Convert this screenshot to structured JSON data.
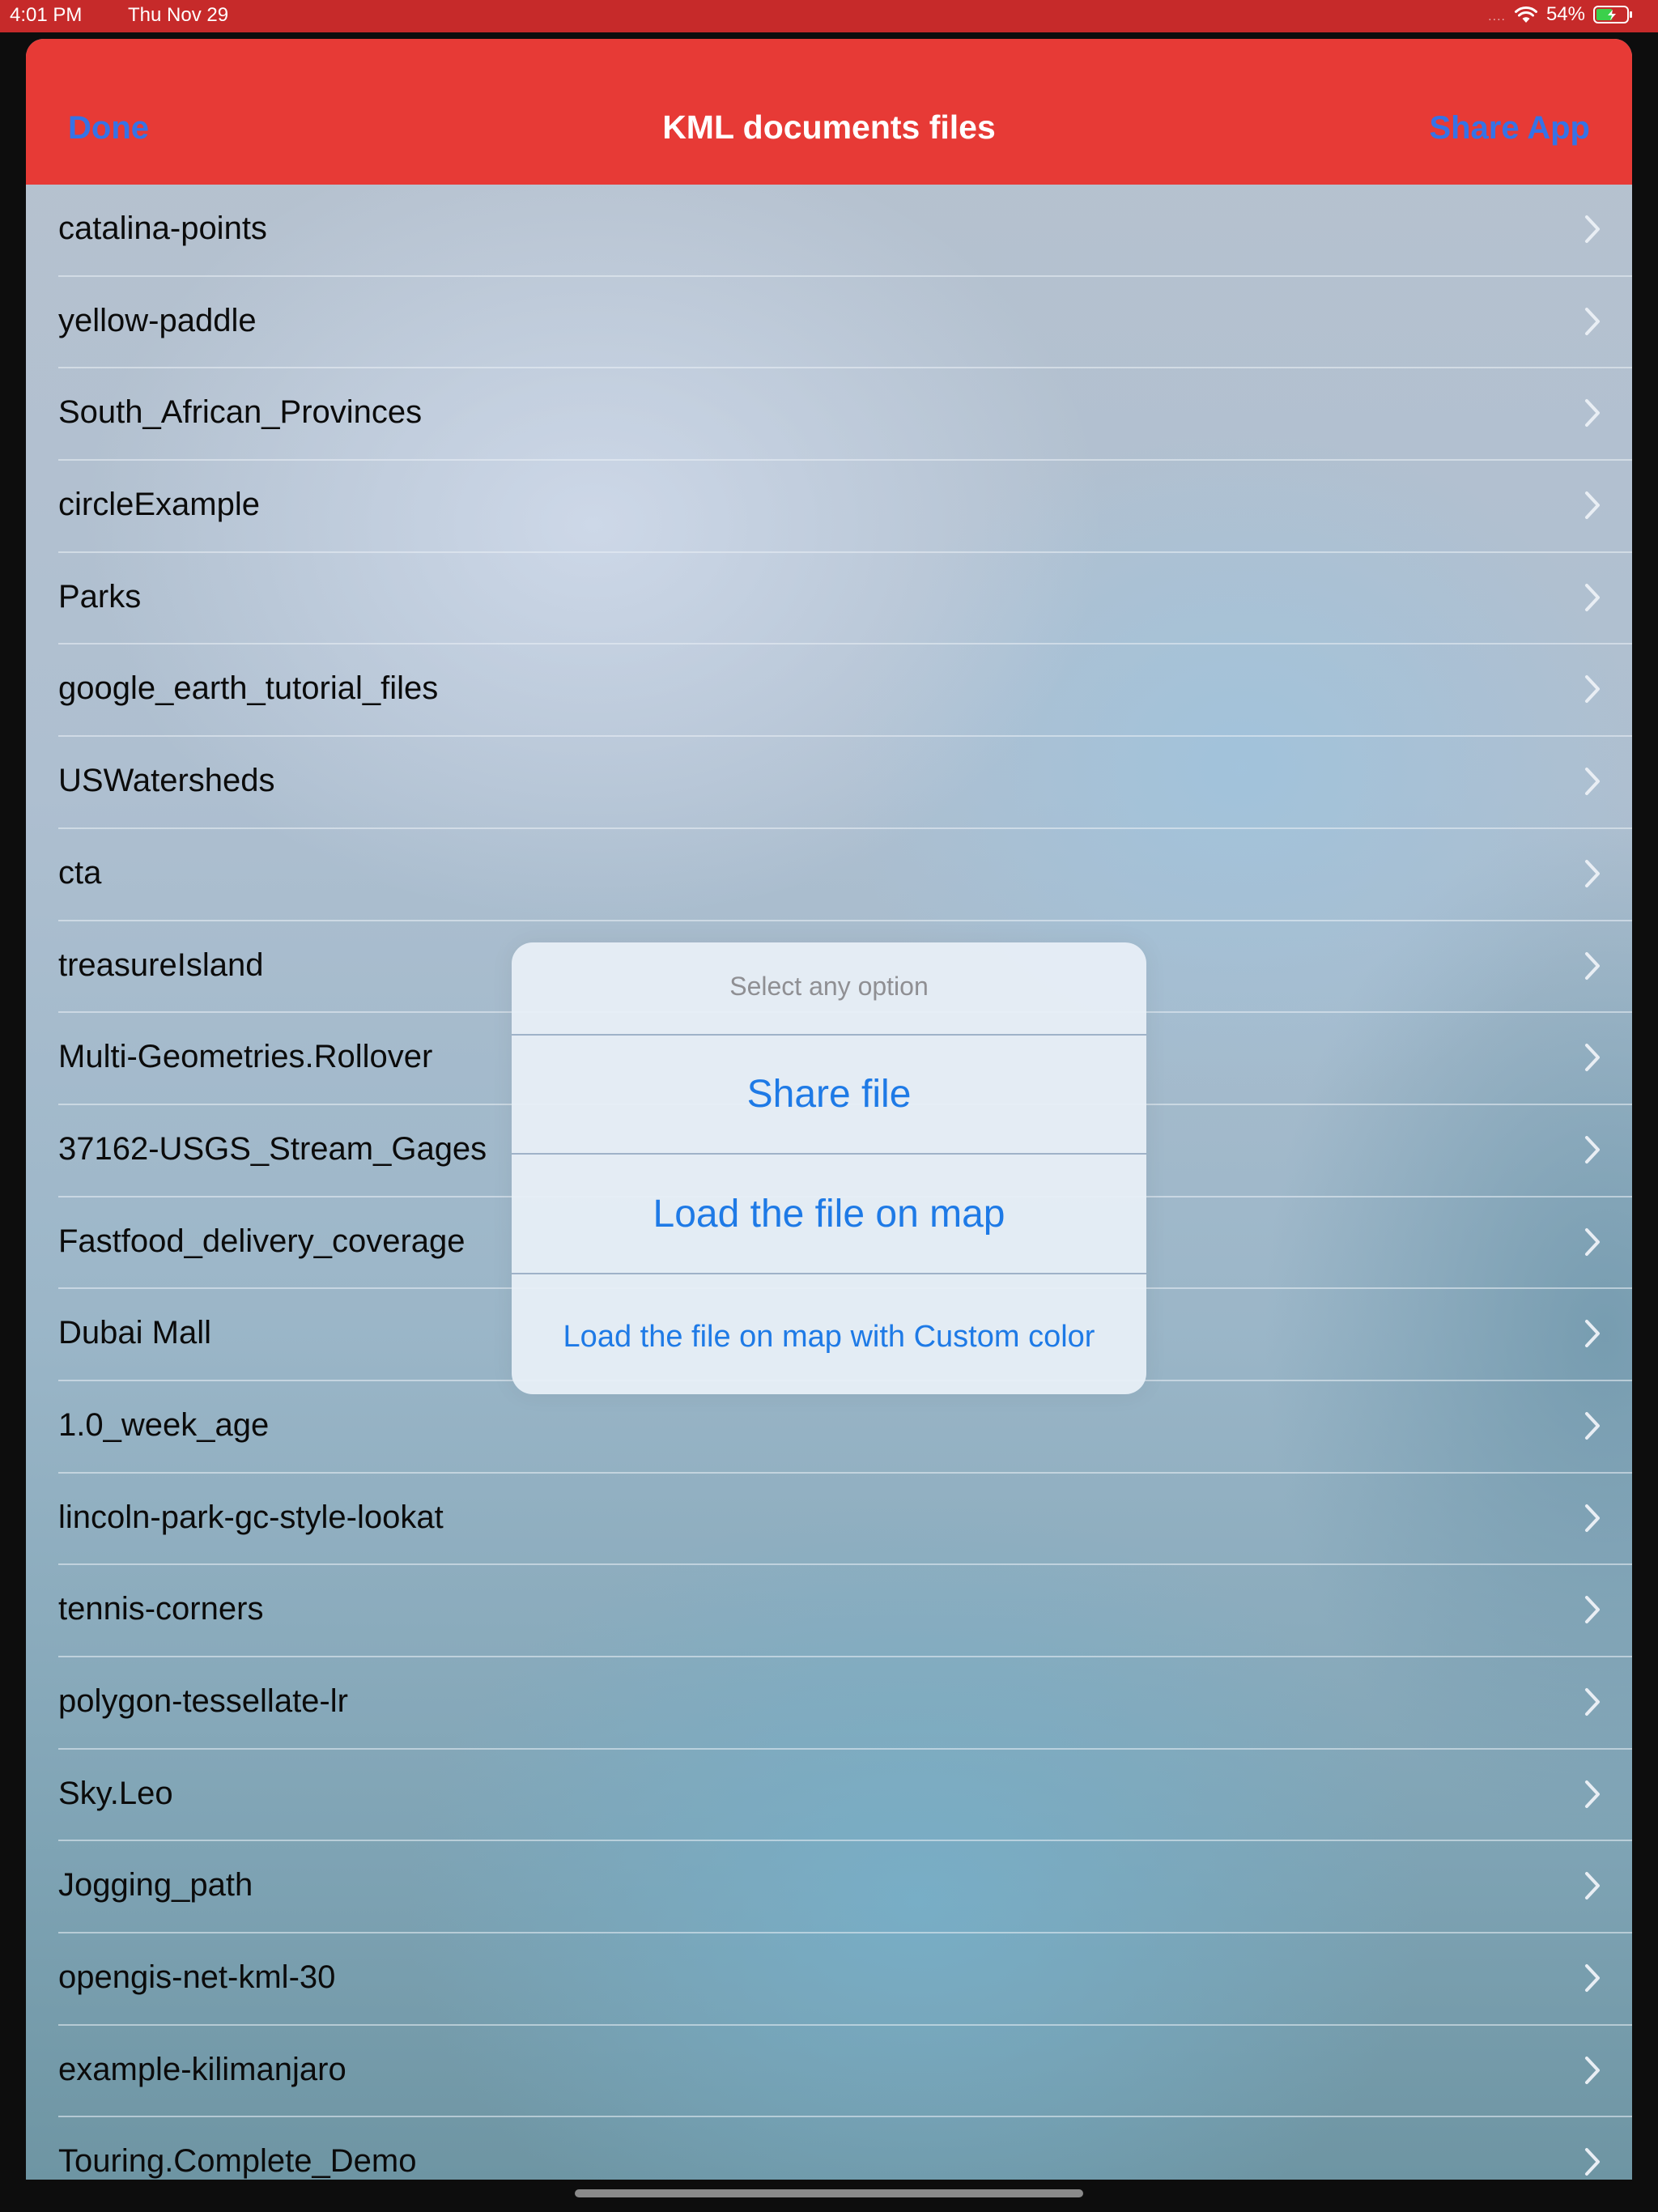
{
  "status_bar": {
    "time": "4:01 PM",
    "date": "Thu Nov 29",
    "signal_dots": "....",
    "battery_percent": "54%",
    "battery_level": 0.54,
    "battery_color": "#3bd04b"
  },
  "nav_bar": {
    "done_label": "Done",
    "title": "KML documents files",
    "share_app_label": "Share App",
    "background_color": "#e73a36",
    "button_color": "#3573e6"
  },
  "files": [
    "catalina-points",
    "yellow-paddle",
    "South_African_Provinces",
    "circleExample",
    "Parks",
    "google_earth_tutorial_files",
    "USWatersheds",
    "cta",
    "treasureIsland",
    "Multi-Geometries.Rollover",
    "37162-USGS_Stream_Gages",
    "Fastfood_delivery_coverage",
    "Dubai Mall",
    "1.0_week_age",
    "lincoln-park-gc-style-lookat",
    "tennis-corners",
    "polygon-tessellate-lr",
    "Sky.Leo",
    "Jogging_path",
    "opengis-net-kml-30",
    "example-kilimanjaro",
    "Touring.Complete_Demo"
  ],
  "row_icon": "chevron-right-icon",
  "action_popover": {
    "title": "Select any option",
    "options": [
      "Share file",
      "Load the file on map",
      "Load the file on map with Custom color"
    ],
    "option_color": "#1e7ae6"
  }
}
